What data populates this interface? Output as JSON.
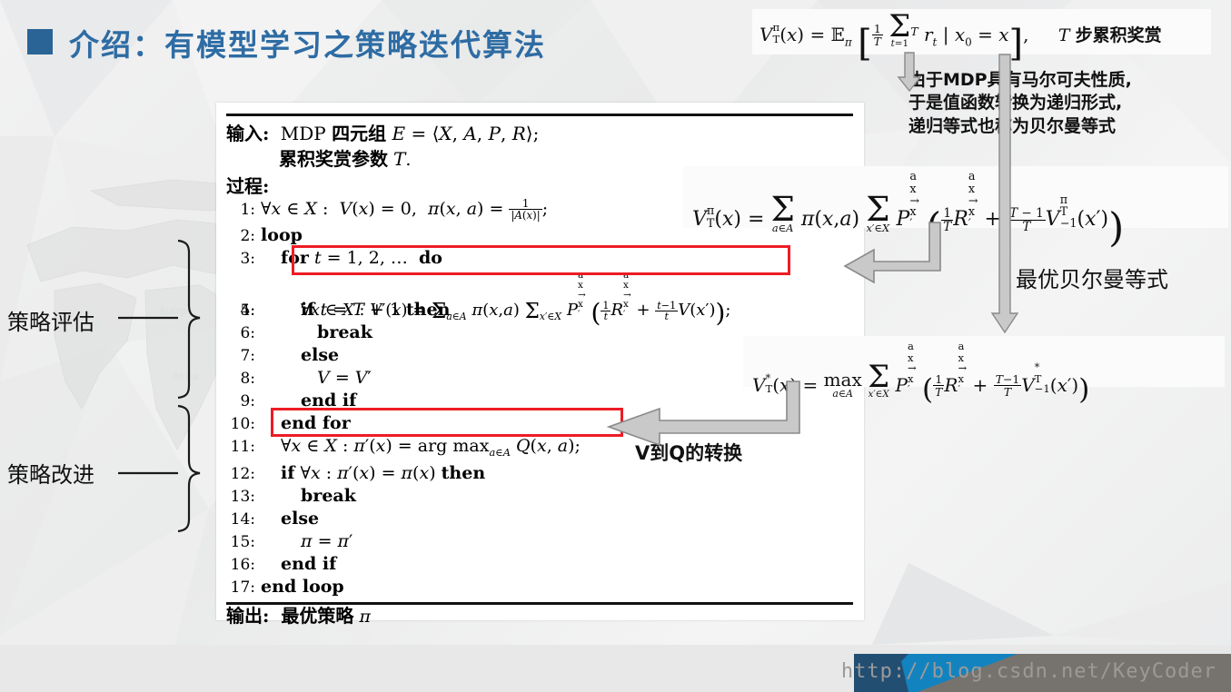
{
  "slide": {
    "title": "介绍：有模型学习之策略迭代算法",
    "accent_color": "#2e6ca4",
    "bullet_color": "#2a6496"
  },
  "algorithm": {
    "input_label": "输入:",
    "input_line1": "MDP 四元组 E = ⟨X, A, P, R⟩;",
    "input_line2": "累积奖赏参数 T.",
    "process_label": "过程:",
    "lines": [
      {
        "num": "1:",
        "text": "∀x ∈ X : V(x) = 0, π(x, a) = 1/|A(x)|;"
      },
      {
        "num": "2:",
        "text": "loop"
      },
      {
        "num": "3:",
        "text": "for t = 1, 2, … do"
      },
      {
        "num": "4:",
        "text": "∀x ∈ X : V'(x) = Σ_{a∈A} π(x,a) Σ_{x'∈X} P^a_{x→x'} ( (1/t) R^a_{x→x'} + ((t-1)/t) V(x') );"
      },
      {
        "num": "5:",
        "text": "if t = T + 1 then"
      },
      {
        "num": "6:",
        "text": "break"
      },
      {
        "num": "7:",
        "text": "else"
      },
      {
        "num": "8:",
        "text": "V = V'"
      },
      {
        "num": "9:",
        "text": "end if"
      },
      {
        "num": "10:",
        "text": "end for"
      },
      {
        "num": "11:",
        "text": "∀x ∈ X : π'(x) = arg max_{a∈A} Q(x, a);"
      },
      {
        "num": "12:",
        "text": "if ∀x : π'(x) = π(x) then"
      },
      {
        "num": "13:",
        "text": "break"
      },
      {
        "num": "14:",
        "text": "else"
      },
      {
        "num": "15:",
        "text": "π = π'"
      },
      {
        "num": "16:",
        "text": "end if"
      },
      {
        "num": "17:",
        "text": "end loop"
      }
    ],
    "output_label": "输出:",
    "output_text": "最优策略 π",
    "highlight_color": "#ed1c24",
    "highlighted_lines": [
      "4",
      "11"
    ]
  },
  "formulas": {
    "cumulative_reward": "V_T^π(x) = E_π[ (1/T) Σ_{t=1}^{T} r_t | x_0 = x ],",
    "cumulative_reward_label": "T 步累积奖赏",
    "bellman": "V_T^π(x) = Σ_{a∈A} π(x,a) Σ_{x'∈X} P^a_{x→x'} ( (1/T) R^a_{x→x'} + ((T-1)/T) V_{T-1}^π(x') )",
    "optimal_bellman": "V_T^*(x) = max_{a∈A} Σ_{x'∈X} P^a_{x→x'} ( (1/T) R^a_{x→x'} + ((T-1)/T) V_{T-1}^*(x') )"
  },
  "notes": {
    "markov_line1": "由于MDP具有马尔可夫性质,",
    "markov_line2": "于是值函数转换为递归形式,",
    "markov_line3": "递归等式也称为贝尔曼等式",
    "optimal_bellman_label": "最优贝尔曼等式",
    "v_to_q_label": "V到Q的转换"
  },
  "side_labels": {
    "policy_evaluation": "策略评估",
    "policy_improvement": "策略改进"
  },
  "footer": {
    "watermark": "http://blog.csdn.net/KeyCoder",
    "navy": "#224e72",
    "blue": "#1383c0",
    "gray": "#76736e"
  }
}
